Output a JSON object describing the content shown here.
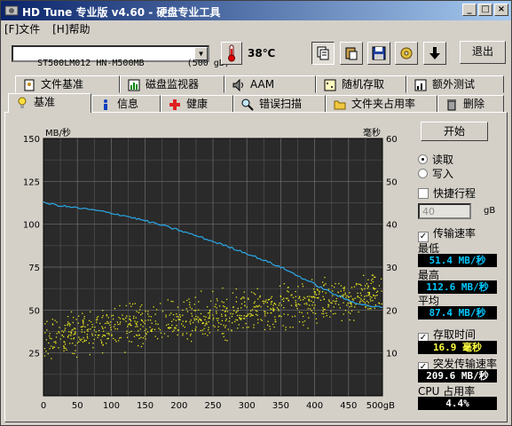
{
  "window": {
    "title": "HD Tune 专业版 v4.60 - 硬盘专业工具",
    "controls": {
      "minimize": "_",
      "maximize": "□",
      "close": "×"
    }
  },
  "menu": {
    "file": "[F]文件",
    "help": "[H]帮助"
  },
  "toolbar": {
    "drive": "ST500LM012 HN-M500MB        (500 gB)",
    "temperature": "38℃",
    "exit_label": "退出"
  },
  "tabs_top": [
    "文件基准",
    "磁盘监视器",
    "AAM",
    "随机存取",
    "额外测试"
  ],
  "tabs_bottom": [
    "基准",
    "信息",
    "健康",
    "错误扫描",
    "文件夹占用率",
    "删除"
  ],
  "chart_data": {
    "type": "scatter",
    "xlabel": "",
    "ylabel": "MB/秒",
    "y2label": "毫秒",
    "xlim": [
      0,
      500
    ],
    "ylim": [
      0,
      150
    ],
    "y2lim": [
      0,
      60
    ],
    "x_ticks": [
      "0",
      "50",
      "100",
      "150",
      "200",
      "250",
      "300",
      "350",
      "400",
      "450",
      "500gB"
    ],
    "y_ticks": [
      "150",
      "125",
      "100",
      "75",
      "50",
      "25"
    ],
    "y2_ticks": [
      "60",
      "50",
      "40",
      "30",
      "20",
      "10"
    ],
    "grid": true,
    "background": "#2a2a2a",
    "series": [
      {
        "kind": "line",
        "color": "#2aa8e8",
        "x": [
          0,
          25,
          50,
          75,
          100,
          125,
          150,
          175,
          200,
          225,
          250,
          275,
          300,
          325,
          350,
          375,
          400,
          425,
          450,
          475,
          500
        ],
        "y": [
          112.6,
          110.8,
          109.5,
          108.2,
          106.5,
          104.5,
          102.0,
          99.4,
          96.5,
          93.3,
          90.0,
          86.6,
          83.0,
          79.0,
          75.0,
          70.0,
          65.0,
          60.0,
          55.5,
          52.8,
          51.4
        ]
      },
      {
        "kind": "scatter",
        "color": "#e8e820",
        "axis": "right",
        "x": [
          0,
          500
        ],
        "y_center_start": 13.5,
        "y_center_end": 24.0,
        "y_spread": 5.5,
        "approx_points": 900
      }
    ]
  },
  "side": {
    "start_label": "开始",
    "read_label": "读取",
    "write_label": "写入",
    "quick_label": "快捷行程",
    "quick_value": "40",
    "quick_unit": "gB",
    "transfer_label": "传输速率",
    "min_label": "最低",
    "min_value": "51.4 MB/秒",
    "max_label": "最高",
    "max_value": "112.6 MB/秒",
    "avg_label": "平均",
    "avg_value": "87.4 MB/秒",
    "access_label": "存取时间",
    "access_value": "16.9 毫秒",
    "burst_label": "突发传输速率",
    "burst_value": "209.6 MB/秒",
    "cpu_label": "CPU 占用率",
    "cpu_value": "4.4%",
    "colors": {
      "accent_blue": "#00c8ff",
      "accent_yellow": "#ffff40"
    }
  }
}
